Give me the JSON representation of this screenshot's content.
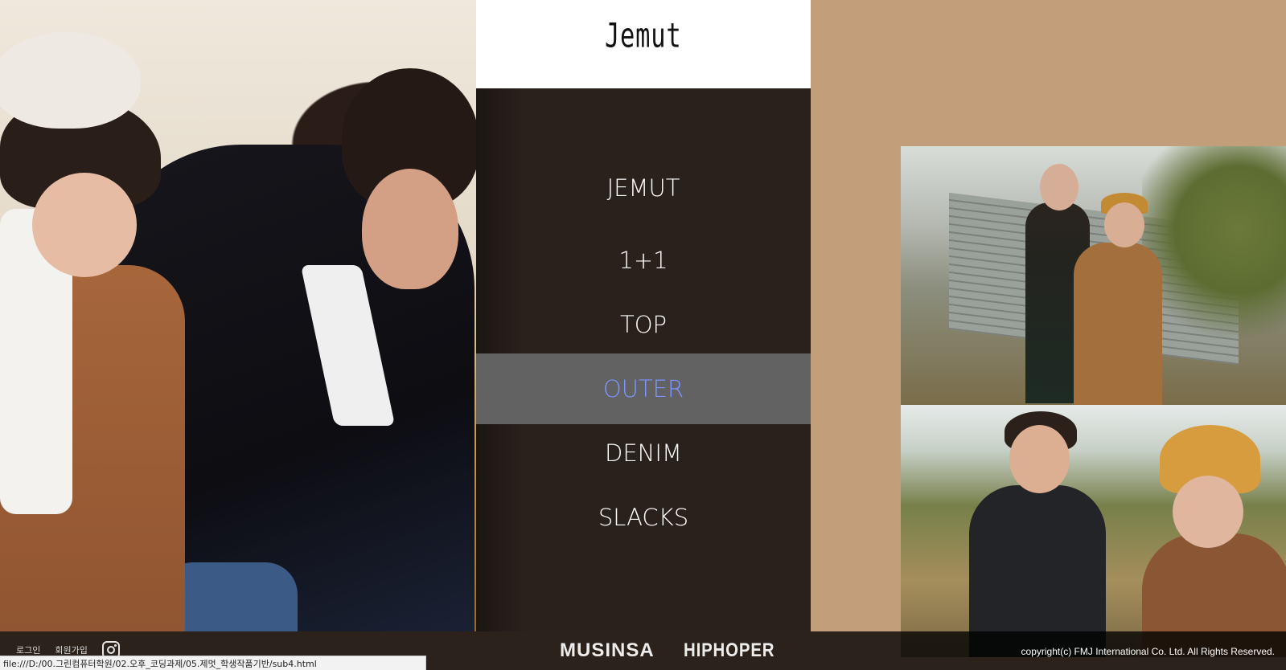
{
  "brand": {
    "logo": "Jemut"
  },
  "nav": {
    "items": [
      {
        "label": "JEMUT",
        "active": false
      },
      {
        "label": "1+1",
        "active": false
      },
      {
        "label": "TOP",
        "active": false
      },
      {
        "label": "OUTER",
        "active": true
      },
      {
        "label": "DENIM",
        "active": false
      },
      {
        "label": "SLACKS",
        "active": false
      }
    ],
    "active_bg": "#626262",
    "active_color": "#7d95ff"
  },
  "footer": {
    "login": "로그인",
    "signup": "회원가입",
    "instagram_icon": "instagram-icon",
    "partners": [
      "MUSINSA",
      "HIPHOPER"
    ],
    "copyright": "copyright(c) FMJ International Co. Ltd. All Rights Reserved."
  },
  "status_bar": {
    "url": "file:///D:/00.그린컴퓨터학원/02.오후_코딩과제/05.제멋_학생작품기반/sub4.html"
  },
  "colors": {
    "page_bg": "#c39e7b",
    "menu_bg": "#2a211d",
    "logo_bg": "#ffffff"
  }
}
